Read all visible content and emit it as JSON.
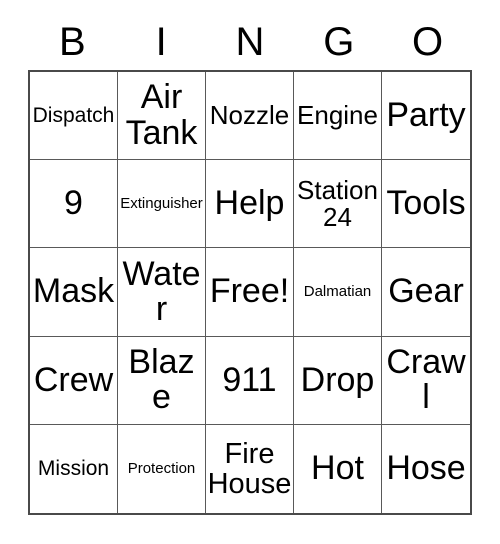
{
  "card": {
    "columns": [
      "B",
      "I",
      "N",
      "G",
      "O"
    ],
    "free_space_label": "Free!",
    "grid": [
      [
        {
          "label": "Dispatch",
          "size": "sm"
        },
        {
          "label": "Air Tank",
          "size": "xl"
        },
        {
          "label": "Nozzle",
          "size": "md"
        },
        {
          "label": "Engine",
          "size": "md"
        },
        {
          "label": "Party",
          "size": "xl"
        }
      ],
      [
        {
          "label": "9",
          "size": "xl"
        },
        {
          "label": "Extinguisher",
          "size": "xs"
        },
        {
          "label": "Help",
          "size": "xl"
        },
        {
          "label": "Station 24",
          "size": "md"
        },
        {
          "label": "Tools",
          "size": "xl"
        }
      ],
      [
        {
          "label": "Mask",
          "size": "xl"
        },
        {
          "label": "Water",
          "size": "xl"
        },
        {
          "label": "Free!",
          "size": "xl"
        },
        {
          "label": "Dalmatian",
          "size": "xs"
        },
        {
          "label": "Gear",
          "size": "xl"
        }
      ],
      [
        {
          "label": "Crew",
          "size": "xl"
        },
        {
          "label": "Blaze",
          "size": "xl"
        },
        {
          "label": "911",
          "size": "xl"
        },
        {
          "label": "Drop",
          "size": "xl"
        },
        {
          "label": "Crawl",
          "size": "xl"
        }
      ],
      [
        {
          "label": "Mission",
          "size": "sm"
        },
        {
          "label": "Protection",
          "size": "xs"
        },
        {
          "label": "Fire House",
          "size": "lg"
        },
        {
          "label": "Hot",
          "size": "xl"
        },
        {
          "label": "Hose",
          "size": "xl"
        }
      ]
    ],
    "colors": {
      "background": "#ffffff",
      "text": "#000000",
      "outer_border": "#4a4a4a",
      "inner_border": "#595959"
    }
  }
}
